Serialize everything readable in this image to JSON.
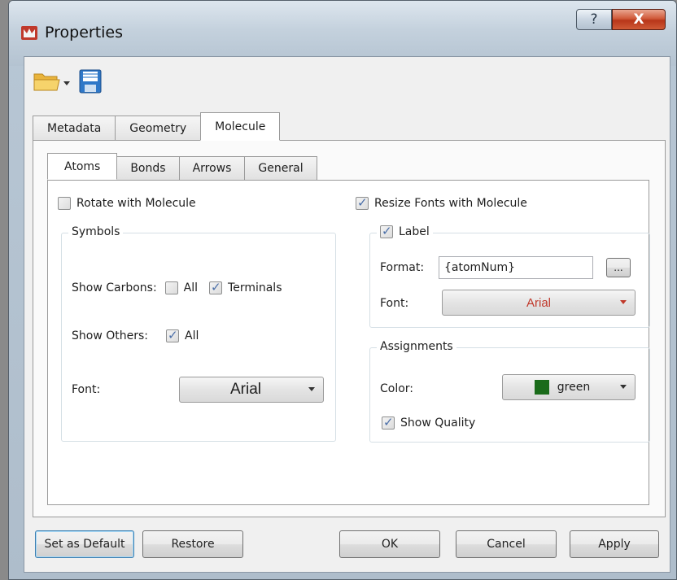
{
  "window": {
    "title": "Properties",
    "help_glyph": "?",
    "close_glyph": "X"
  },
  "toolbar": {
    "items": [
      {
        "icon": "folder-open-icon"
      },
      {
        "icon": "save-icon"
      }
    ]
  },
  "tabs": [
    {
      "label": "Metadata",
      "active": false
    },
    {
      "label": "Geometry",
      "active": false
    },
    {
      "label": "Molecule",
      "active": true
    }
  ],
  "subtabs": [
    {
      "label": "Atoms",
      "active": true
    },
    {
      "label": "Bonds",
      "active": false
    },
    {
      "label": "Arrows",
      "active": false
    },
    {
      "label": "General",
      "active": false
    }
  ],
  "atoms": {
    "rotate_with_molecule": {
      "label": "Rotate with Molecule",
      "checked": false
    },
    "resize_fonts": {
      "label": "Resize Fonts with Molecule",
      "checked": true
    },
    "symbols": {
      "title": "Symbols",
      "show_carbons_label": "Show Carbons:",
      "carbons_all": {
        "label": "All",
        "checked": false
      },
      "carbons_terminals": {
        "label": "Terminals",
        "checked": true
      },
      "show_others_label": "Show Others:",
      "others_all": {
        "label": "All",
        "checked": true
      },
      "font_label": "Font:",
      "font_value": "Arial"
    },
    "label_group": {
      "title": "Label",
      "checked": true,
      "format_label": "Format:",
      "format_value": "{atomNum}",
      "browse_label": "...",
      "font_label": "Font:",
      "font_value": "Arial",
      "font_color": "#c0392b"
    },
    "assignments": {
      "title": "Assignments",
      "color_label": "Color:",
      "color_value": "green",
      "color_swatch": "#1a6b1a",
      "show_quality": {
        "label": "Show Quality",
        "checked": true
      }
    }
  },
  "buttons": {
    "set_default": "Set as Default",
    "restore": "Restore",
    "ok": "OK",
    "cancel": "Cancel",
    "apply": "Apply"
  }
}
